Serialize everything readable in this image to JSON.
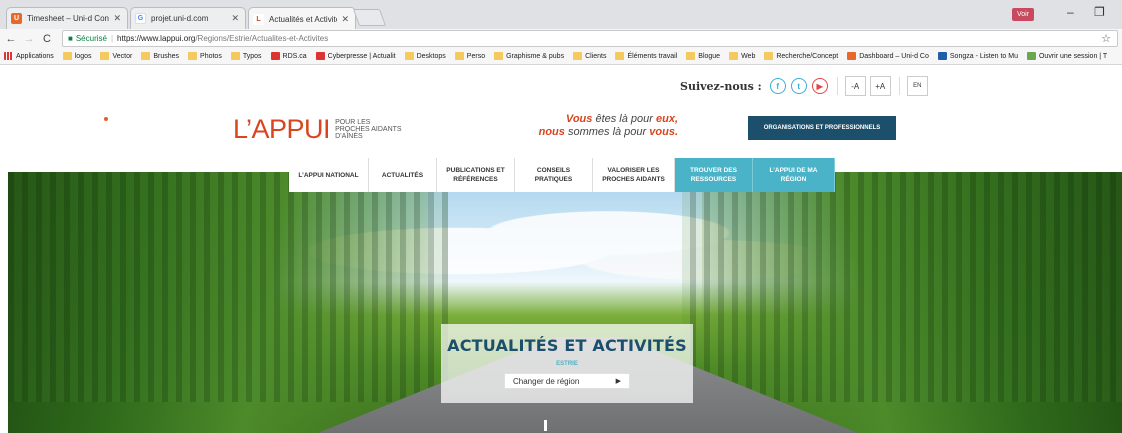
{
  "browser": {
    "tabs": [
      {
        "title": "Timesheet – Uni-d Conse",
        "icon": "timesheet-favicon",
        "active": false
      },
      {
        "title": "projet.uni-d.com",
        "icon": "google-favicon",
        "active": false
      },
      {
        "title": "Actualités et Activités",
        "icon": "lappui-favicon",
        "active": true
      }
    ],
    "profile_label": "Voir",
    "window_controls": {
      "minimize": "–",
      "maximize": "❐"
    },
    "secure_label": "Sécurisé",
    "url_host": "https://www.lappui.org",
    "url_path": "/Regions/Estrie/Actualites-et-Activites",
    "bookmarks": [
      {
        "label": "Applications",
        "icon": "apps"
      },
      {
        "label": "logos",
        "icon": "folder"
      },
      {
        "label": "Vector",
        "icon": "folder"
      },
      {
        "label": "Brushes",
        "icon": "folder"
      },
      {
        "label": "Photos",
        "icon": "folder"
      },
      {
        "label": "Typos",
        "icon": "folder"
      },
      {
        "label": "RDS.ca",
        "icon": "red"
      },
      {
        "label": "Cyberpresse | Actualit",
        "icon": "red"
      },
      {
        "label": "Desktops",
        "icon": "folder"
      },
      {
        "label": "Perso",
        "icon": "folder"
      },
      {
        "label": "Graphisme & pubs",
        "icon": "folder"
      },
      {
        "label": "Clients",
        "icon": "folder"
      },
      {
        "label": "Éléments travail",
        "icon": "folder"
      },
      {
        "label": "Blogue",
        "icon": "folder"
      },
      {
        "label": "Web",
        "icon": "folder"
      },
      {
        "label": "Recherche/Concept",
        "icon": "folder"
      },
      {
        "label": "Dashboard – Uni-d Co",
        "icon": "orange"
      },
      {
        "label": "Songza - Listen to Mu",
        "icon": "blue"
      },
      {
        "label": "Ouvrir une session | T",
        "icon": "green"
      }
    ]
  },
  "site": {
    "follow_label": "Suivez-nous :",
    "social": [
      {
        "icon": "facebook-icon",
        "glyph": "f"
      },
      {
        "icon": "twitter-icon",
        "glyph": "t"
      },
      {
        "icon": "youtube-icon",
        "glyph": "▶"
      }
    ],
    "text_smaller": "-A",
    "text_larger": "+A",
    "lang_switch": "EN",
    "logo": {
      "word": "L’APPUI",
      "sub1": "POUR LES",
      "sub2": "PROCHES AIDANTS",
      "sub3": "D’AÎNÉS"
    },
    "tagline": {
      "l1a": "Vous",
      "l1b": " êtes là pour ",
      "l1c": "eux,",
      "l2a": "nous",
      "l2b": " sommes là pour ",
      "l2c": "vous."
    },
    "org_button": "ORGANISATIONS ET PROFESSIONNELS",
    "nav": [
      {
        "l1": "L’APPUI NATIONAL",
        "l2": "",
        "teal": false
      },
      {
        "l1": "ACTUALITÉS",
        "l2": "",
        "teal": false
      },
      {
        "l1": "PUBLICATIONS ET",
        "l2": "RÉFÉRENCES",
        "teal": false
      },
      {
        "l1": "CONSEILS",
        "l2": "PRATIQUES",
        "teal": false
      },
      {
        "l1": "VALORISER LES",
        "l2": "PROCHES AIDANTS",
        "teal": false
      },
      {
        "l1": "TROUVER DES",
        "l2": "RESSOURCES",
        "teal": true
      },
      {
        "l1": "L’APPUI DE MA",
        "l2": "RÉGION",
        "teal": true
      }
    ],
    "hero": {
      "title": "ACTUALITÉS ET ACTIVITÉS",
      "region": "ESTRIE",
      "change_region": "Changer de région"
    }
  },
  "colors": {
    "brand_orange": "#d8451f",
    "brand_teal": "#4bb3c7",
    "brand_navy": "#1c4f6b"
  }
}
